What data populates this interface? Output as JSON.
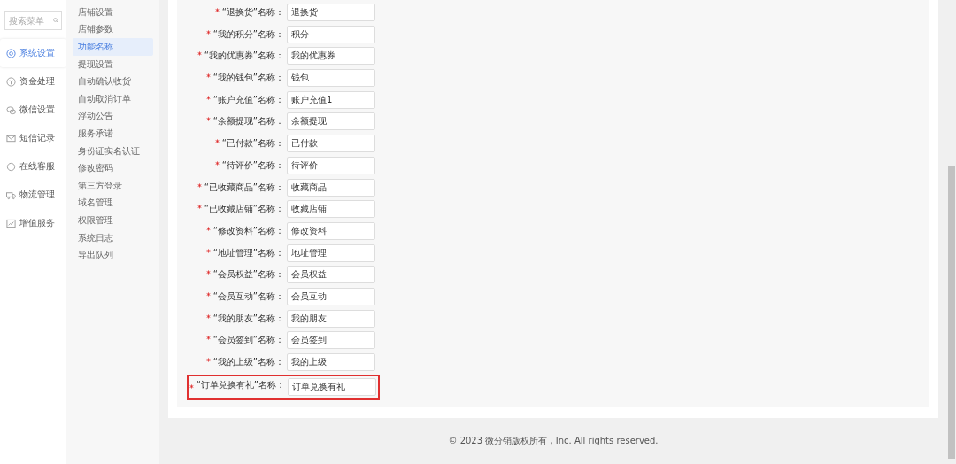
{
  "search": {
    "placeholder": "搜索菜单"
  },
  "nav": [
    {
      "label": "系统设置",
      "kind": "gear",
      "selected": true
    },
    {
      "label": "资金处理",
      "kind": "coin",
      "selected": false
    },
    {
      "label": "微信设置",
      "kind": "chat",
      "selected": false
    },
    {
      "label": "短信记录",
      "kind": "mail",
      "selected": false
    },
    {
      "label": "在线客服",
      "kind": "bubble",
      "selected": false
    },
    {
      "label": "物流管理",
      "kind": "truck",
      "selected": false
    },
    {
      "label": "增值服务",
      "kind": "chart",
      "selected": false
    }
  ],
  "submenu": [
    {
      "label": "店铺设置",
      "selected": false
    },
    {
      "label": "店铺参数",
      "selected": false
    },
    {
      "label": "功能名称",
      "selected": true
    },
    {
      "label": "提现设置",
      "selected": false
    },
    {
      "label": "自动确认收货",
      "selected": false
    },
    {
      "label": "自动取消订单",
      "selected": false
    },
    {
      "label": "浮动公告",
      "selected": false
    },
    {
      "label": "服务承诺",
      "selected": false
    },
    {
      "label": "身份证实名认证",
      "selected": false
    },
    {
      "label": "修改密码",
      "selected": false
    },
    {
      "label": "第三方登录",
      "selected": false
    },
    {
      "label": "域名管理",
      "selected": false
    },
    {
      "label": "权限管理",
      "selected": false
    },
    {
      "label": "系统日志",
      "selected": false
    },
    {
      "label": "导出队列",
      "selected": false
    }
  ],
  "fields": [
    {
      "label": "“退换货”名称：",
      "value": "退换货",
      "required": true,
      "highlighted": false
    },
    {
      "label": "“我的积分”名称：",
      "value": "积分",
      "required": true,
      "highlighted": false
    },
    {
      "label": "“我的优惠券”名称：",
      "value": "我的优惠券",
      "required": true,
      "highlighted": false
    },
    {
      "label": "“我的钱包”名称：",
      "value": "钱包",
      "required": true,
      "highlighted": false
    },
    {
      "label": "“账户充值”名称：",
      "value": "账户充值1",
      "required": true,
      "highlighted": false
    },
    {
      "label": "“余额提现”名称：",
      "value": "余额提现",
      "required": true,
      "highlighted": false
    },
    {
      "label": "“已付款”名称：",
      "value": "已付款",
      "required": true,
      "highlighted": false
    },
    {
      "label": "“待评价”名称：",
      "value": "待评价",
      "required": true,
      "highlighted": false
    },
    {
      "label": "“已收藏商品”名称：",
      "value": "收藏商品",
      "required": true,
      "highlighted": false
    },
    {
      "label": "“已收藏店铺”名称：",
      "value": "收藏店铺",
      "required": true,
      "highlighted": false
    },
    {
      "label": "“修改资料”名称：",
      "value": "修改资料",
      "required": true,
      "highlighted": false
    },
    {
      "label": "“地址管理”名称：",
      "value": "地址管理",
      "required": true,
      "highlighted": false
    },
    {
      "label": "“会员权益”名称：",
      "value": "会员权益",
      "required": true,
      "highlighted": false
    },
    {
      "label": "“会员互动”名称：",
      "value": "会员互动",
      "required": true,
      "highlighted": false
    },
    {
      "label": "“我的朋友”名称：",
      "value": "我的朋友",
      "required": true,
      "highlighted": false
    },
    {
      "label": "“会员签到”名称：",
      "value": "会员签到",
      "required": true,
      "highlighted": false
    },
    {
      "label": "“我的上级”名称：",
      "value": "我的上级",
      "required": true,
      "highlighted": false
    },
    {
      "label": "“订单兑换有礼”名称：",
      "value": "订单兑换有礼",
      "required": true,
      "highlighted": true
    }
  ],
  "footer": "© 2023 微分销版权所有 , Inc. All rights reserved."
}
